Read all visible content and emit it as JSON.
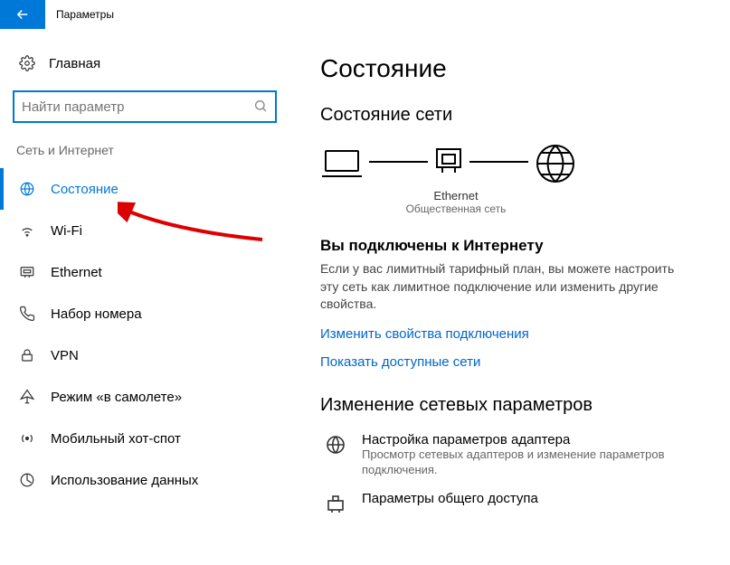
{
  "titlebar": {
    "title": "Параметры"
  },
  "sidebar": {
    "home": "Главная",
    "search_placeholder": "Найти параметр",
    "category": "Сеть и Интернет",
    "items": [
      {
        "label": "Состояние"
      },
      {
        "label": "Wi-Fi"
      },
      {
        "label": "Ethernet"
      },
      {
        "label": "Набор номера"
      },
      {
        "label": "VPN"
      },
      {
        "label": "Режим «в самолете»"
      },
      {
        "label": "Мобильный хот-спот"
      },
      {
        "label": "Использование данных"
      }
    ]
  },
  "main": {
    "heading": "Состояние",
    "status_heading": "Состояние сети",
    "eth_label": "Ethernet",
    "eth_sub": "Общественная сеть",
    "connected_title": "Вы подключены к Интернету",
    "connected_body": "Если у вас лимитный тарифный план, вы можете настроить эту сеть как лимитное подключение или изменить другие свойства.",
    "link_change_props": "Изменить свойства подключения",
    "link_show_nets": "Показать доступные сети",
    "change_params_heading": "Изменение сетевых параметров",
    "adapter_title": "Настройка параметров адаптера",
    "adapter_sub": "Просмотр сетевых адаптеров и изменение параметров подключения.",
    "sharing_title": "Параметры общего доступа"
  }
}
